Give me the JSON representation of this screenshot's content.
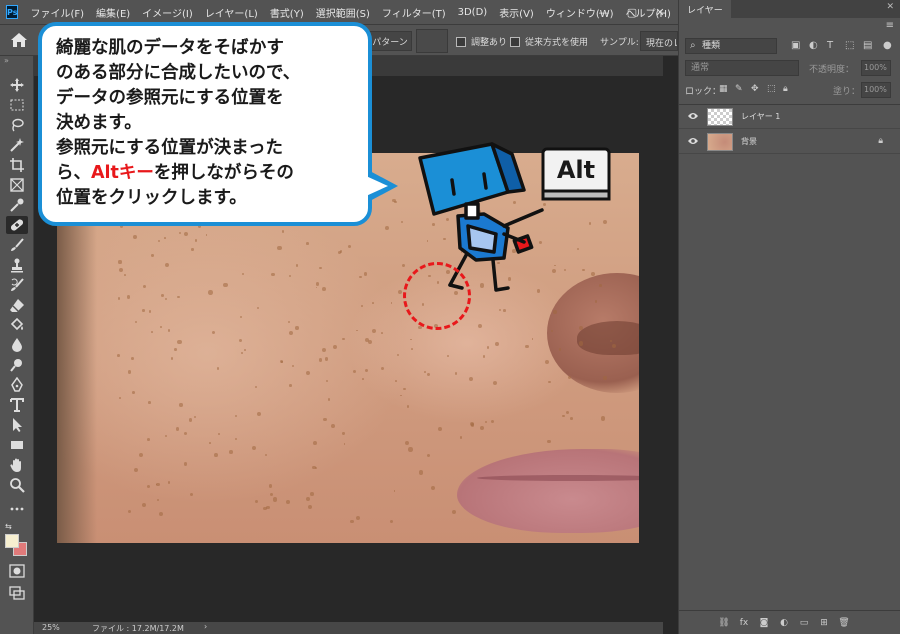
{
  "menubar": {
    "logo": "Ps",
    "items": [
      "ファイル(F)",
      "編集(E)",
      "イメージ(I)",
      "レイヤー(L)",
      "書式(Y)",
      "選択範囲(S)",
      "フィルター(T)",
      "3D(D)",
      "表示(V)",
      "ウィンドウ(W)",
      "ヘルプ(H)"
    ],
    "window_controls": [
      "—",
      "▢",
      "✕"
    ]
  },
  "options": {
    "pattern_label": "パターン",
    "aligned_label": "調整あり",
    "legacy_label": "従来方式を使用",
    "sample_label": "サンプル:",
    "sample_value": "現在のレイヤー"
  },
  "status": {
    "zoom": "25%",
    "file_info": "ファイル : 17.2M/17.2M",
    "arrow": "›"
  },
  "layers_panel": {
    "tab_label": "レイヤー",
    "close": "✕",
    "menu": "≡",
    "filter_label": "種類",
    "blend_mode": "通常",
    "opacity_label": "不透明度：",
    "opacity_value": "100%",
    "lock_label": "ロック：",
    "fill_label": "塗り：",
    "fill_value": "100%",
    "layers": [
      {
        "name": "レイヤー 1",
        "type": "transparent",
        "locked": false
      },
      {
        "name": "背景",
        "type": "photo",
        "locked": true
      }
    ]
  },
  "bubble": {
    "lines": [
      "綺麗な肌のデータをそばかす",
      "のある部分に合成したいので、",
      "データの参照元にする位置を",
      "決めます。",
      "参照元にする位置が決まった"
    ],
    "line6_before": "ら、",
    "line6_highlight": "Altキー",
    "line6_after": "を押しながらその",
    "line7": "位置をクリックします。"
  },
  "alt_key_label": "Alt",
  "colors": {
    "accent_blue": "#1b8fd6",
    "highlight_red": "#e8181b",
    "foreground_color": "#f6efd0",
    "background_color": "#e07a7a"
  }
}
